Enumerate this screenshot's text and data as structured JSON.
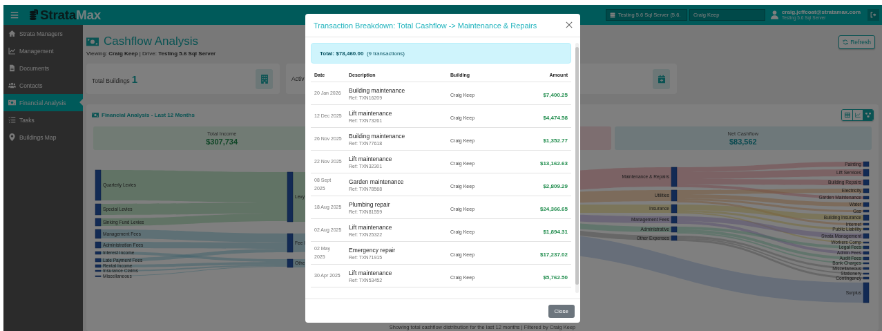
{
  "topbar": {
    "brand": {
      "part_1": "Strata",
      "part_2": "Max"
    },
    "server_select": {
      "value": "Testing 5.6 Sql Server (5.6."
    },
    "building_field": {
      "value": "Craig Keep"
    },
    "user": {
      "email": "craig.jeffcoat@stratamax.com",
      "server": "Testing 5.6 Sql Server"
    }
  },
  "sidebar": {
    "items": [
      {
        "label": "Strata Managers",
        "selected": false
      },
      {
        "label": "Management",
        "selected": false
      },
      {
        "label": "Documents",
        "selected": false
      },
      {
        "label": "Contacts",
        "selected": false
      },
      {
        "label": "Financial Analysis",
        "selected": true
      },
      {
        "label": "Tasks",
        "selected": false
      },
      {
        "label": "Buildings Map",
        "selected": false
      }
    ]
  },
  "page": {
    "title": "Cashflow Analysis",
    "subtitle": "Viewing: **Craig Keep**  | Drive: **Testing 5.6 Sql Server**",
    "refresh_button": "Refresh"
  },
  "stat_cards": [
    {
      "kind": "buildings",
      "label": "Total Buildings",
      "value": "1"
    },
    {
      "kind": "calendar",
      "label": "Activ"
    }
  ],
  "panel": {
    "title": "Financial Analysis - Last 12 Months",
    "view_buttons": [
      {
        "kind": "table",
        "selected": false
      },
      {
        "kind": "line",
        "selected": false
      },
      {
        "kind": "sankey",
        "selected": true
      }
    ],
    "tiles": [
      {
        "kind": "income",
        "label": "Total Income",
        "value": "$307,734"
      },
      {
        "kind": "expense"
      },
      {
        "kind": "net",
        "label": "Net Cashflow",
        "value": "$83,562"
      }
    ],
    "sankey": {
      "columns": [
        [
          {
            "label": "Quarterly Levies"
          },
          {
            "label": "Special Levies"
          },
          {
            "label": "Sinking Fund Levies"
          },
          {
            "label": "Management Fees"
          },
          {
            "label": "Administration Fees"
          },
          {
            "label": "Interest Income"
          },
          {
            "label": "Late Payment Fees"
          },
          {
            "label": "Rental Income"
          },
          {
            "label": "Insurance Claims"
          },
          {
            "label": "Miscellaneous"
          }
        ],
        [
          {
            "label": "Levy"
          },
          {
            "label": "Fee I"
          },
          {
            "label": "Othe"
          }
        ],
        [
          {
            "label": "Maintenance & Repairs"
          },
          {
            "label": "Utilities"
          },
          {
            "label": "Insurance"
          },
          {
            "label": "Management Fees"
          },
          {
            "label": "Administrative"
          },
          {
            "label": "Other Expenses"
          }
        ],
        [
          {
            "label": "Painting"
          },
          {
            "label": "Lift Services"
          },
          {
            "label": "Building Repairs"
          },
          {
            "label": "Electricity"
          },
          {
            "label": "Garden Maintenance"
          },
          {
            "label": "Water"
          },
          {
            "label": "Gas"
          },
          {
            "label": "Building Insurance"
          },
          {
            "label": "Internet"
          },
          {
            "label": "Public Liability"
          },
          {
            "label": "Strata Management"
          },
          {
            "label": "Workers Comp"
          },
          {
            "label": "Legal Fees"
          },
          {
            "label": "Admin Fees"
          },
          {
            "label": "Audit Fees"
          },
          {
            "label": "Bank Charges"
          },
          {
            "label": "Miscellaneous"
          },
          {
            "label": "Stationery"
          },
          {
            "label": "Contingency"
          },
          {
            "label": "Surplus"
          }
        ]
      ]
    },
    "caption": "Showing total cashflow distribution for the last 12 months | Filtered by Craig Keep"
  },
  "modal": {
    "title": "Transaction Breakdown: Total Cashflow -> Maintenance & Repairs",
    "total": "**Total: $78,460.00**  (9 transactions)",
    "columns": [
      "Date",
      "Description",
      "Building",
      "Amount"
    ],
    "rows": [
      {
        "date": "20 Jan 2026",
        "description": "Building maintenance",
        "ref": "Ref: TXN16209",
        "building": "Craig Keep",
        "amount": "$7,400.25"
      },
      {
        "date": "12 Dec 2025",
        "description": "Lift maintenance",
        "ref": "Ref: TXN73261",
        "building": "Craig Keep",
        "amount": "$4,474.58"
      },
      {
        "date": "26 Nov 2025",
        "description": "Building maintenance",
        "ref": "Ref: TXN77618",
        "building": "Craig Keep",
        "amount": "$1,352.77"
      },
      {
        "date": "22 Nov 2025",
        "description": "Lift maintenance",
        "ref": "Ref: TXN32301",
        "building": "Craig Keep",
        "amount": "$13,162.63"
      },
      {
        "date": "08 Sept 2025",
        "description": "Garden maintenance",
        "ref": "Ref: TXN78568",
        "building": "Craig Keep",
        "amount": "$2,809.29"
      },
      {
        "date": "18 Aug 2025",
        "description": "Plumbing repair",
        "ref": "Ref: TXN81559",
        "building": "Craig Keep",
        "amount": "$24,366.65"
      },
      {
        "date": "02 Aug 2025",
        "description": "Lift maintenance",
        "ref": "Ref: TXN25322",
        "building": "Craig Keep",
        "amount": "$1,894.31"
      },
      {
        "date": "02 May 2025",
        "description": "Emergency repair",
        "ref": "Ref: TXN71915",
        "building": "Craig Keep",
        "amount": "$17,237.02"
      },
      {
        "date": "30 Apr 2025",
        "description": "Lift maintenance",
        "ref": "Ref: TXN53452",
        "building": "Craig Keep",
        "amount": "$5,762.50"
      }
    ],
    "close_button": "Close"
  }
}
